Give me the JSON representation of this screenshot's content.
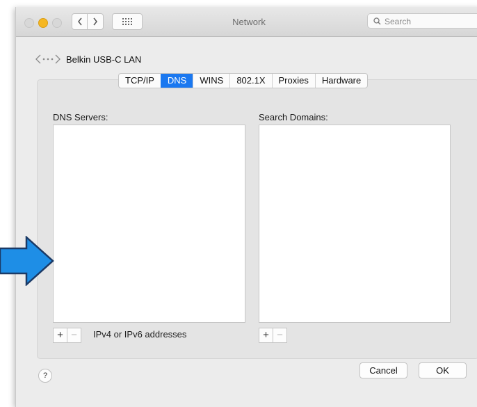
{
  "window": {
    "title": "Network",
    "search_placeholder": "Search"
  },
  "interface": {
    "name": "Belkin USB-C LAN"
  },
  "tabs": [
    {
      "label": "TCP/IP",
      "active": false
    },
    {
      "label": "DNS",
      "active": true
    },
    {
      "label": "WINS",
      "active": false
    },
    {
      "label": "802.1X",
      "active": false
    },
    {
      "label": "Proxies",
      "active": false
    },
    {
      "label": "Hardware",
      "active": false
    }
  ],
  "dns": {
    "servers_label": "DNS Servers:",
    "domains_label": "Search Domains:",
    "servers": [],
    "domains": [],
    "add_symbol": "+",
    "remove_symbol": "−",
    "hint": "IPv4 or IPv6 addresses"
  },
  "footer": {
    "help": "?",
    "cancel": "Cancel",
    "ok": "OK"
  },
  "colors": {
    "accent": "#1a78f0",
    "arrow": "#1e8ee6"
  }
}
